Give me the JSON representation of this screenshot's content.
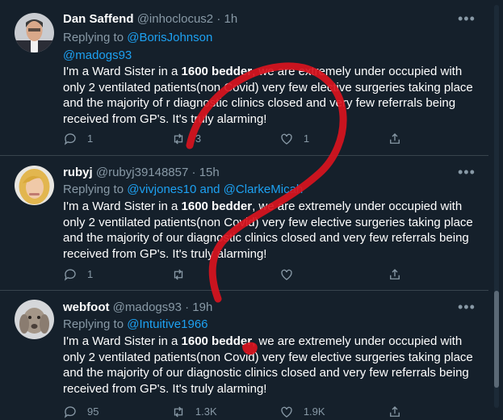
{
  "tweets": [
    {
      "name": "Dan Saffend",
      "handle": "@inhoclocus2",
      "dot": "·",
      "time": "1h",
      "replying_prefix": "Replying to",
      "replying_to": "@BorisJohnson",
      "mention_line": "@madogs93",
      "body_pre": "I'm a Ward Sister in a ",
      "body_bold": "1600 bedder",
      "body_post": ", we are extremely under occupied with only 2 ventilated patients(non Covid) very few elective surgeries taking place and the majority of r diagnostic clinics closed and very few referrals being received from GP's. It's truly alarming!",
      "replies": "1",
      "retweets": "3",
      "likes": "1"
    },
    {
      "name": "rubyj",
      "handle": "@rubyj39148857",
      "dot": "·",
      "time": "15h",
      "replying_prefix": "Replying to",
      "replying_to": "@vivjones10 and @ClarkeMicah",
      "body_pre": "I'm a Ward Sister in a ",
      "body_bold": "1600 bedder",
      "body_post": ", we are extremely under occupied with only 2 ventilated patients(non Covid) very few elective surgeries taking place and the majority of our diagnostic clinics closed and very few referrals being received from GP's. It's truly alarming!",
      "replies": "1",
      "retweets": "",
      "likes": ""
    },
    {
      "name": "webfoot",
      "handle": "@madogs93",
      "dot": "·",
      "time": "19h",
      "replying_prefix": "Replying to",
      "replying_to": "@Intuitive1966",
      "body_pre": "I'm a Ward Sister in a ",
      "body_bold": "1600 bedder",
      "body_post": ", we are extremely under occupied with only 2 ventilated patients(non Covid) very few elective surgeries taking place and the majority of our diagnostic clinics closed and very few referrals being received from GP's. It's truly alarming!",
      "replies": "95",
      "retweets": "1.3K",
      "likes": "1.9K"
    }
  ],
  "icons": [
    "reply-icon",
    "retweet-icon",
    "like-icon",
    "share-icon",
    "more-icon"
  ],
  "colors": {
    "background": "#15202b",
    "divider": "#38444d",
    "secondary_text": "#8899a6",
    "link": "#1da1f2",
    "annotation": "#d9141e"
  }
}
